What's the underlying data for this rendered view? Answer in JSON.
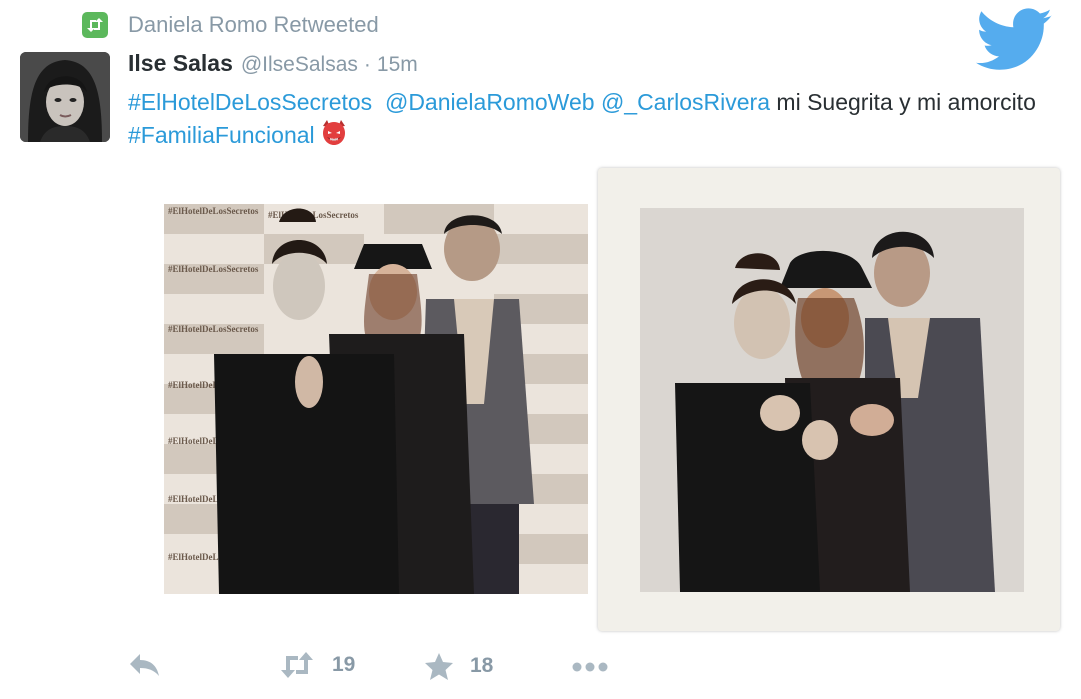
{
  "retweet_context": {
    "label": "Daniela Romo Retweeted",
    "icon": "retweet-icon"
  },
  "author": {
    "display_name": "Ilse Salas",
    "screen_name": "@IlseSalsas",
    "separator": "·",
    "time": "15m"
  },
  "tweet": {
    "hashtag_1": "#ElHotelDeLosSecretos",
    "mention_1": "@DanielaRomoWeb",
    "mention_2": "@_CarlosRivera",
    "text_1": " mi Suegrita y mi amorcito ",
    "hashtag_2": "#FamiliaFuncional",
    "emoji": "devil-face-icon"
  },
  "photos": [
    {
      "description": "photo-1"
    },
    {
      "description": "photo-2"
    }
  ],
  "backdrop_text": "#ElHotelDeLosSecretos",
  "actions": {
    "reply_icon": "reply-icon",
    "retweet_count": "19",
    "favorite_count": "18",
    "more_icon": "more-icon"
  },
  "colors": {
    "link": "#2b9ad9",
    "muted": "#8899a6",
    "retweet_badge": "#5cb85c",
    "twitter_blue": "#55acee",
    "devil": "#e23e3e"
  }
}
